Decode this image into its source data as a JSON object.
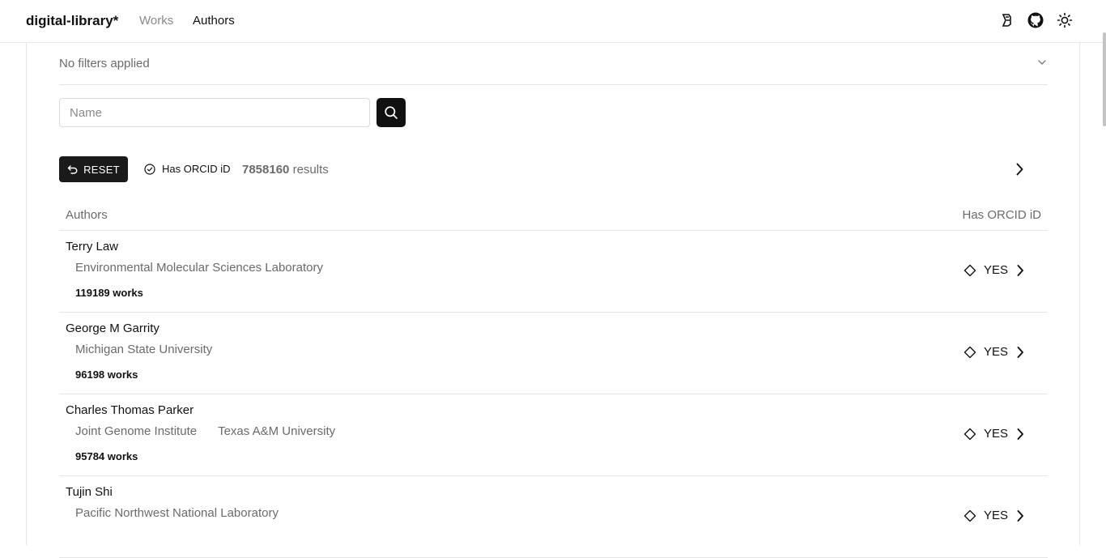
{
  "header": {
    "brand": "digital-library*",
    "nav": {
      "works": "Works",
      "authors": "Authors"
    },
    "icons": [
      "logo-icon",
      "github-icon",
      "sun-icon"
    ]
  },
  "filters": {
    "summary": "No filters applied",
    "search_placeholder": "Name",
    "reset_label": "RESET",
    "orcid_filter_label": "Has ORCID iD",
    "results_count": "7858160",
    "results_suffix": "results"
  },
  "table": {
    "columns": {
      "authors": "Authors",
      "orcid": "Has ORCID iD"
    },
    "rows": [
      {
        "name": "Terry Law",
        "affiliations": [
          "Environmental Molecular Sciences Laboratory"
        ],
        "works": "119189 works",
        "orcid": "YES"
      },
      {
        "name": "George M Garrity",
        "affiliations": [
          "Michigan State University"
        ],
        "works": "96198 works",
        "orcid": "YES"
      },
      {
        "name": "Charles Thomas Parker",
        "affiliations": [
          "Joint Genome Institute",
          "Texas A&M University"
        ],
        "works": "95784 works",
        "orcid": "YES"
      },
      {
        "name": "Tujin Shi",
        "affiliations": [
          "Pacific Northwest National Laboratory"
        ],
        "works": "",
        "orcid": "YES"
      }
    ]
  }
}
